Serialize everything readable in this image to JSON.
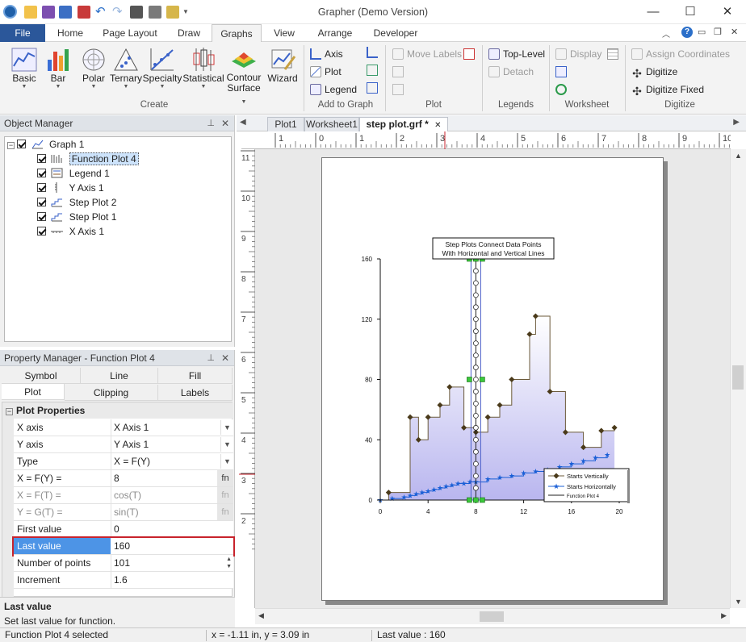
{
  "app": {
    "title": "Grapher (Demo Version)"
  },
  "ribbon_tabs": [
    {
      "label": "File"
    },
    {
      "label": "Home"
    },
    {
      "label": "Page Layout"
    },
    {
      "label": "Draw"
    },
    {
      "label": "Graphs"
    },
    {
      "label": "View"
    },
    {
      "label": "Arrange"
    },
    {
      "label": "Developer"
    }
  ],
  "create_group": {
    "label": "Create",
    "buttons": [
      "Basic",
      "Bar",
      "Polar",
      "Ternary",
      "Specialty",
      "Statistical",
      "Contour\nSurface",
      "Wizard"
    ]
  },
  "add_to_graph": {
    "label": "Add to Graph",
    "items": [
      "Axis",
      "Plot",
      "Legend"
    ]
  },
  "plot_group": {
    "label": "Plot",
    "items": [
      "Move Labels"
    ]
  },
  "legends_group": {
    "label": "Legends",
    "items": [
      "Top-Level",
      "Detach"
    ]
  },
  "worksheet_group": {
    "label": "Worksheet",
    "items": [
      "Display"
    ]
  },
  "digitize_group": {
    "label": "Digitize",
    "items": [
      "Assign Coordinates",
      "Digitize",
      "Digitize Fixed"
    ]
  },
  "object_manager": {
    "title": "Object Manager",
    "tree": [
      {
        "label": "Graph 1",
        "level": 0,
        "selected": false
      },
      {
        "label": "Function Plot 4",
        "level": 1,
        "selected": true
      },
      {
        "label": "Legend 1",
        "level": 1,
        "selected": false
      },
      {
        "label": "Y Axis 1",
        "level": 1,
        "selected": false
      },
      {
        "label": "Step Plot 2",
        "level": 1,
        "selected": false
      },
      {
        "label": "Step Plot 1",
        "level": 1,
        "selected": false
      },
      {
        "label": "X Axis 1",
        "level": 1,
        "selected": false
      }
    ]
  },
  "property_manager": {
    "title": "Property Manager - Function Plot 4",
    "tabs_row1": [
      "Symbol",
      "Line",
      "Fill"
    ],
    "tabs_row2": [
      "Plot",
      "Clipping",
      "Labels"
    ],
    "section": "Plot Properties",
    "rows": [
      {
        "key": "X axis",
        "value": "X Axis 1",
        "control": "dropdown",
        "disabled": false
      },
      {
        "key": "Y axis",
        "value": "Y Axis 1",
        "control": "dropdown",
        "disabled": false
      },
      {
        "key": "Type",
        "value": "X = F(Y)",
        "control": "dropdown",
        "disabled": false
      },
      {
        "key": "X = F(Y) =",
        "value": "8",
        "control": "fn",
        "disabled": false
      },
      {
        "key": "X = F(T) =",
        "value": "cos(T)",
        "control": "fn",
        "disabled": true
      },
      {
        "key": "Y = G(T) =",
        "value": "sin(T)",
        "control": "fn",
        "disabled": true
      },
      {
        "key": "First value",
        "value": "0",
        "control": "none",
        "disabled": false
      },
      {
        "key": "Last value",
        "value": "160",
        "control": "none",
        "disabled": false,
        "highlight": true
      },
      {
        "key": "Number of points",
        "value": "101",
        "control": "spin",
        "disabled": false
      },
      {
        "key": "Increment",
        "value": "1.6",
        "control": "none",
        "disabled": false
      }
    ],
    "desc_title": "Last value",
    "desc_text": "Set last value for function."
  },
  "doc_tabs": [
    {
      "label": "Plot1",
      "active": false
    },
    {
      "label": "Worksheet1",
      "active": false
    },
    {
      "label": "step plot.grf *",
      "active": true
    }
  ],
  "ruler": {
    "h_labels": [
      "1",
      "0",
      "1",
      "2",
      "3",
      "4",
      "5",
      "6",
      "7",
      "8",
      "9",
      "10"
    ],
    "v_labels": [
      "11",
      "10",
      "9",
      "8",
      "7",
      "6",
      "5",
      "4",
      "3",
      "2"
    ]
  },
  "status": {
    "left": "Function Plot 4 selected",
    "middle": "x = -1.11 in, y = 3.09 in",
    "right": "Last value : 160"
  },
  "chart_data": {
    "type": "step",
    "title_lines": [
      "Step Plots Connect Data Points",
      "With Horizontal and Vertical Lines"
    ],
    "x_ticks": [
      "0",
      "4",
      "8",
      "12",
      "16",
      "20"
    ],
    "y_ticks": [
      "0",
      "40",
      "80",
      "120",
      "160"
    ],
    "xlim": [
      0,
      20
    ],
    "ylim": [
      0,
      160
    ],
    "series": [
      {
        "name": "Starts Vertically",
        "color": "#6b5a3a",
        "x": [
          0.7,
          2.5,
          3.2,
          4.0,
          5.0,
          5.8,
          7.0,
          8.0,
          9.0,
          10.0,
          11.0,
          12.5,
          13.0,
          14.2,
          15.5,
          17.0,
          18.5,
          19.6
        ],
        "y": [
          5,
          55,
          40,
          55,
          63,
          75,
          48,
          45,
          55,
          63,
          80,
          110,
          122,
          72,
          45,
          35,
          46,
          48
        ]
      },
      {
        "name": "Starts Horizontally",
        "color": "#1a5fd6",
        "x": [
          0,
          1,
          2,
          2.5,
          3,
          3.5,
          4,
          4.5,
          5,
          5.5,
          6,
          6.5,
          7,
          7.5,
          8,
          9,
          10,
          11,
          12,
          13,
          14,
          15,
          16,
          17,
          18,
          19
        ],
        "y": [
          0,
          1,
          2,
          3,
          4,
          5,
          6,
          7,
          8,
          9,
          10,
          11,
          11,
          12,
          12,
          14,
          15,
          16,
          18,
          19,
          20,
          22,
          24,
          26,
          28,
          30
        ]
      },
      {
        "name": "Function Plot 4",
        "color": "#222222",
        "x_constant": 8,
        "y_range": [
          0,
          160
        ]
      }
    ],
    "legend_position": "bottom-right",
    "accent_fill": "#b9b6ef"
  }
}
